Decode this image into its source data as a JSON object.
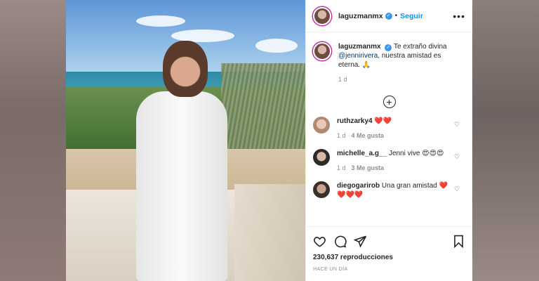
{
  "post": {
    "username": "laguzmanmx",
    "follow_label": "Seguir",
    "caption": {
      "username": "laguzmanmx",
      "text_before": "Te extraño divina",
      "mention": "@jennirivera",
      "text_after": ", nuestra amistad es eterna. 🙏",
      "time": "1 d"
    },
    "comments": [
      {
        "username": "ruthzarky4",
        "text": "❤️❤️",
        "time": "1 d",
        "likes": "4 Me gusta"
      },
      {
        "username": "michelle_a.g__",
        "text": "Jenni vive 😍😍😍",
        "time": "1 d",
        "likes": "3 Me gusta"
      },
      {
        "username": "diegogarirob",
        "text": "Una gran amistad ❤️❤️❤️❤️",
        "time": "",
        "likes": ""
      }
    ],
    "views": "230,637 reproducciones",
    "posted_ago": "HACE UN DÍA"
  },
  "colors": {
    "accent_blue": "#0095f6",
    "verified_blue": "#3897f0",
    "story_ring": "#c32aa3",
    "heart_red": "#e0245e"
  },
  "icons": [
    "verified-icon",
    "more-options-icon",
    "load-more-icon",
    "like-icon",
    "comment-icon",
    "share-icon",
    "bookmark-icon",
    "heart-small-icon"
  ]
}
